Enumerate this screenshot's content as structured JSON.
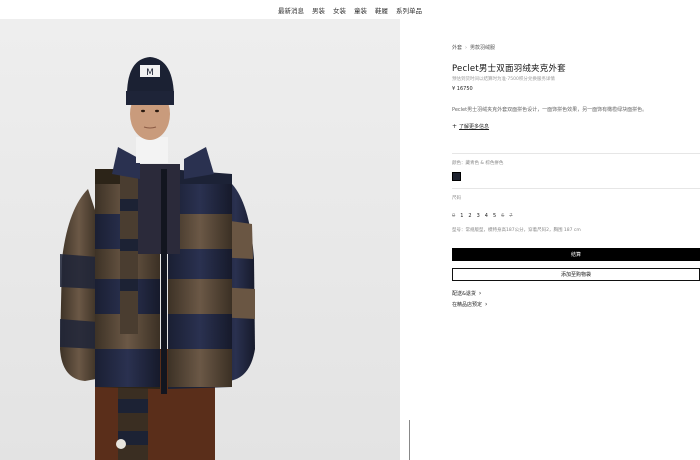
{
  "nav": {
    "items": [
      "最新消息",
      "男装",
      "女装",
      "童装",
      "鞋履",
      "系列单品"
    ]
  },
  "product": {
    "breadcrumb": [
      "外套",
      "男款羽绒服"
    ],
    "title": "Peclet男士双面羽绒夹克外套",
    "subline": "预估到货时间以结算时为准·7500积分兑换服务详情",
    "price": "¥ 16750",
    "description": "Peclet男士羽绒夹克外套双面拼色设计，一面饰拼色效果，另一面饰有橄榄绿块面拼色。",
    "more_label": "了解更多信息",
    "color_label": "颜色：藏青色 & 棕色拼色",
    "size_label": "尺码",
    "sizes": [
      {
        "label": "0",
        "sold": true
      },
      {
        "label": "1",
        "sold": false
      },
      {
        "label": "2",
        "sold": false
      },
      {
        "label": "3",
        "sold": false
      },
      {
        "label": "4",
        "sold": false
      },
      {
        "label": "5",
        "sold": false
      },
      {
        "label": "6",
        "sold": true
      },
      {
        "label": "7",
        "sold": true
      }
    ],
    "size_note": "型号：常规版型，模特身高187公分，穿着尺码2，胸围 187 cm",
    "primary_button": "结算",
    "secondary_button": "添加至购物袋",
    "link_shipping": "配送&退货",
    "link_store": "在精品店预定"
  },
  "colors": {
    "swatch": "#1f2330",
    "primary_button_bg": "#000000"
  }
}
